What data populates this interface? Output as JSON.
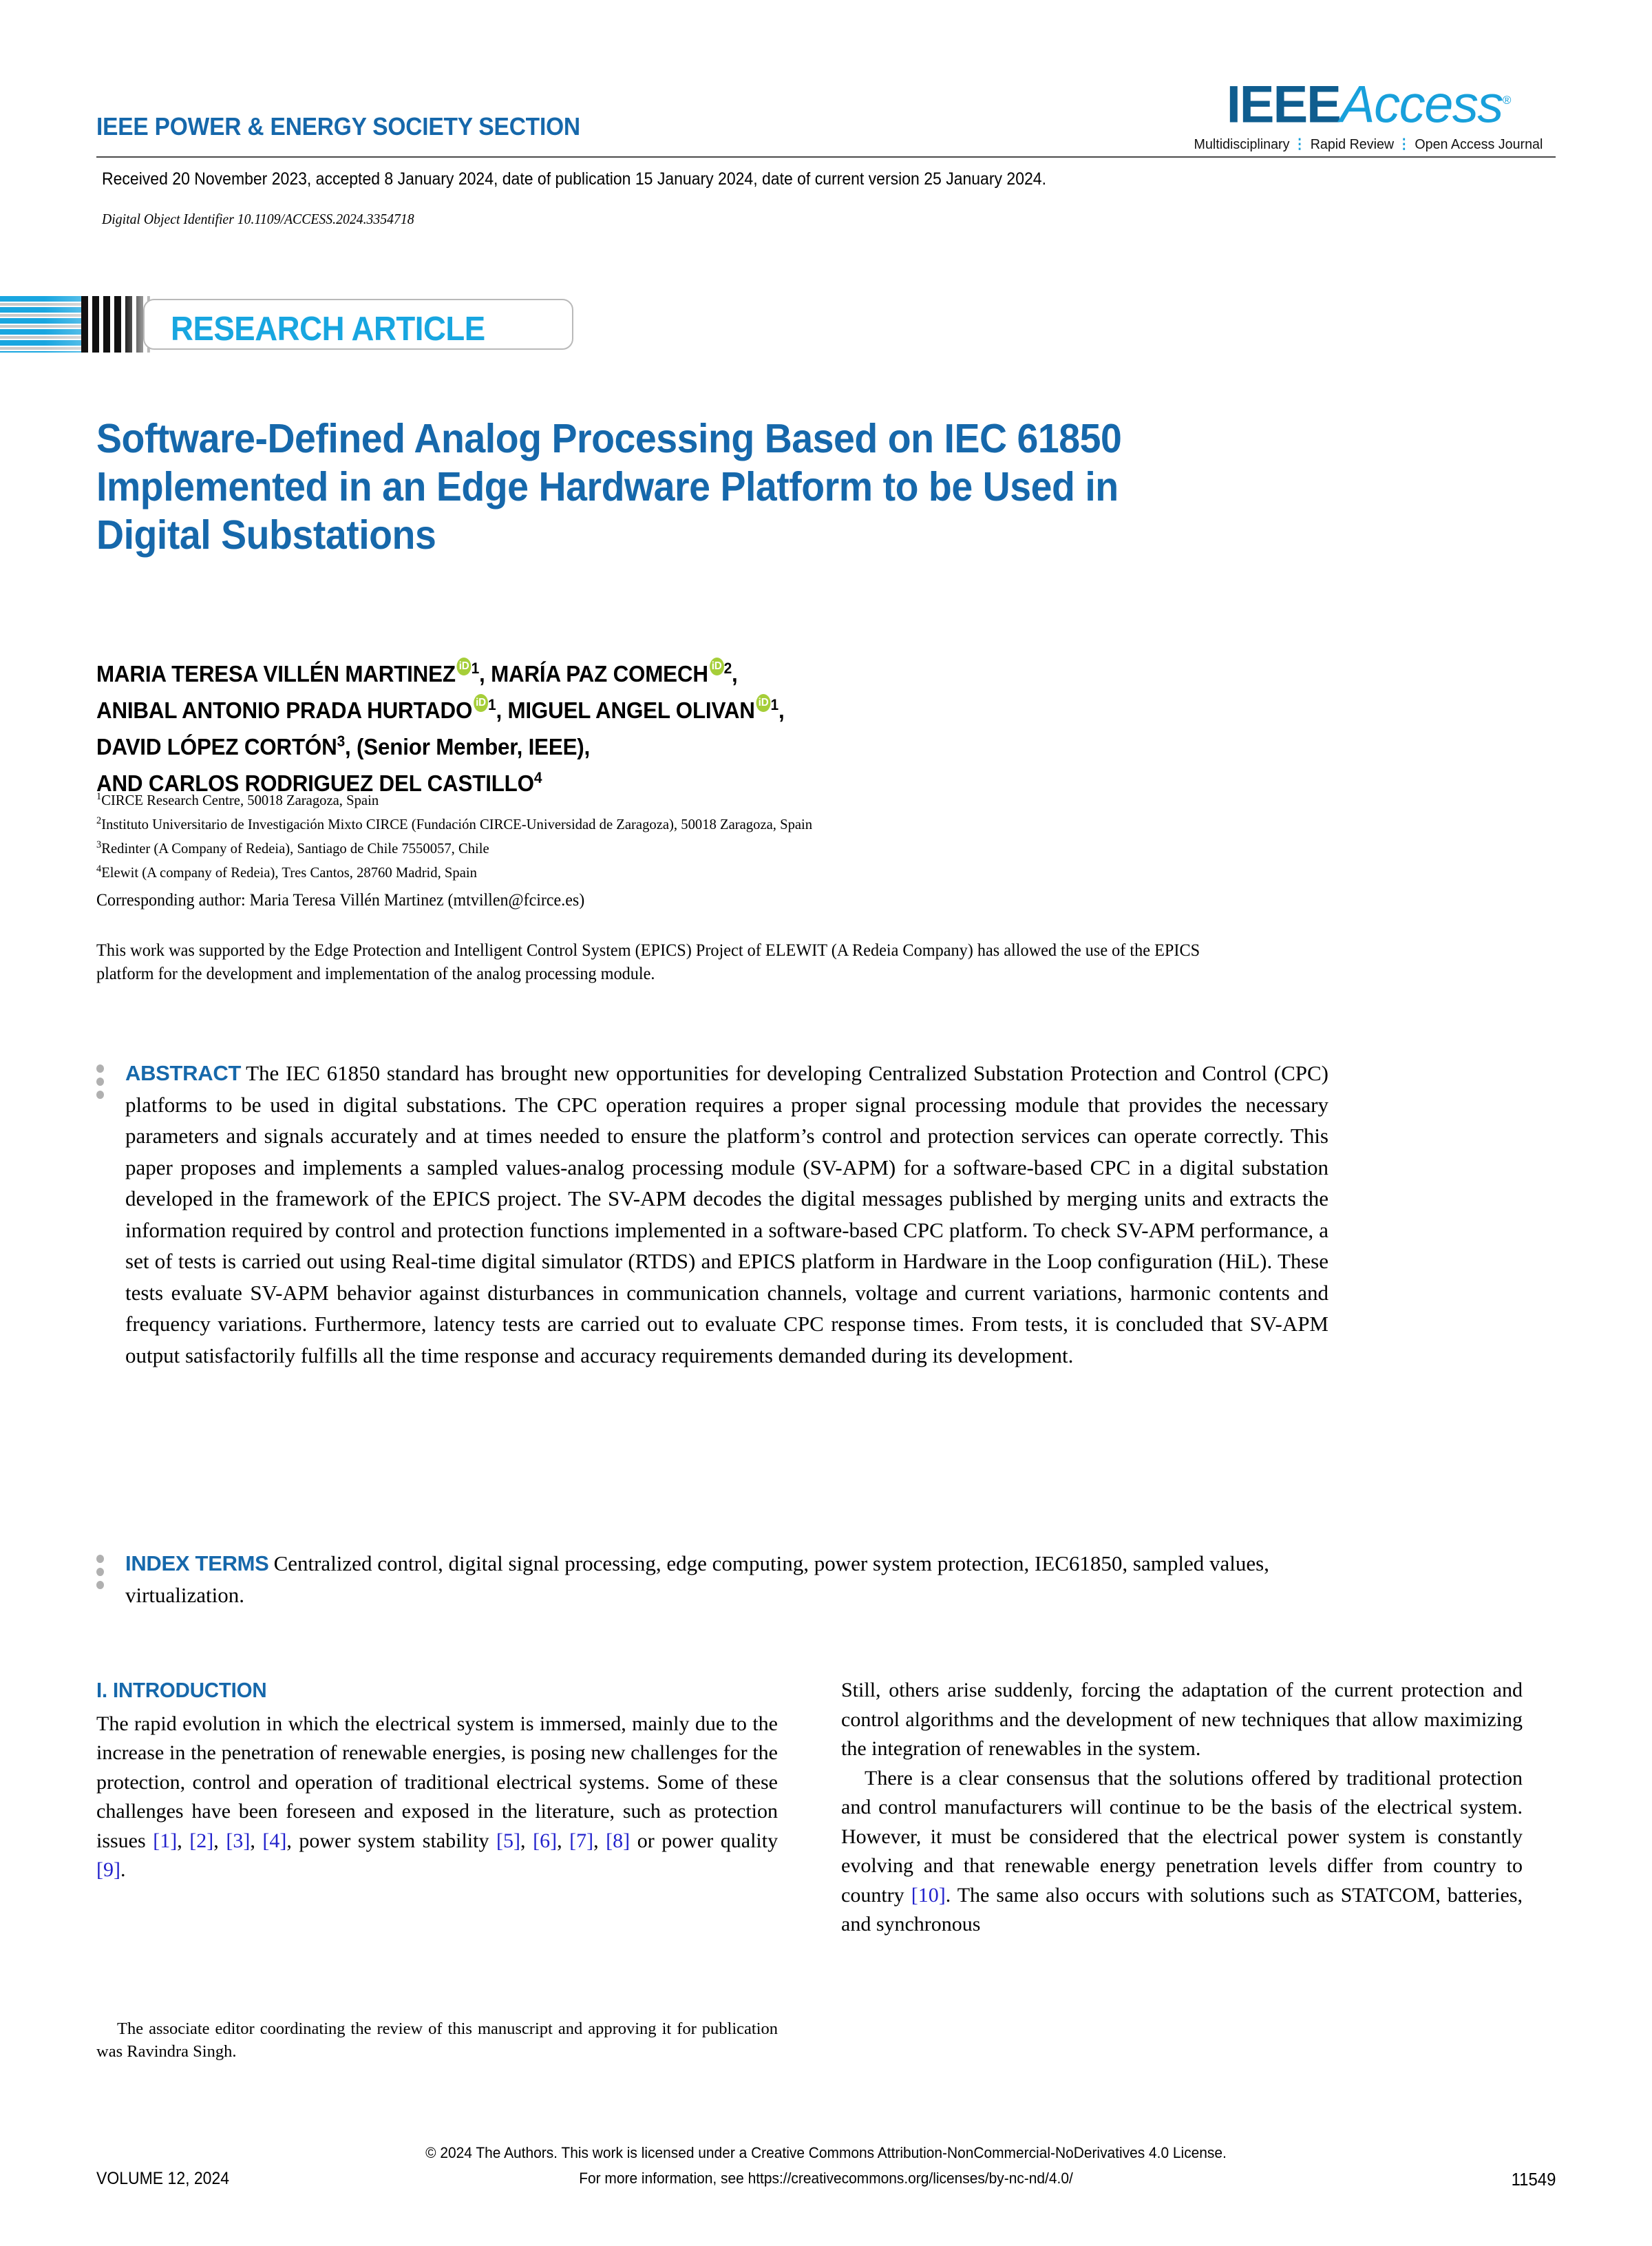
{
  "header": {
    "society_section": "IEEE POWER & ENERGY SOCIETY SECTION",
    "logo": {
      "ieee": "IEEE",
      "access": "Access",
      "registered_mark": "®",
      "tagline_1": "Multidisciplinary",
      "tagline_2": "Rapid Review",
      "tagline_3": "Open Access Journal",
      "separator": "⋮"
    }
  },
  "publication": {
    "dates": "Received 20 November 2023, accepted 8 January 2024, date of publication 15 January 2024, date of current version 25 January 2024.",
    "doi": "Digital Object Identifier 10.1109/ACCESS.2024.3354718"
  },
  "banner": {
    "label": "RESEARCH ARTICLE"
  },
  "title": "Software-Defined Analog Processing Based on IEC 61850 Implemented in an Edge Hardware Platform to be Used in Digital Substations",
  "authors": {
    "line1_a": "MARIA TERESA VILLÉN MARTINEZ",
    "line1_a_sup": "1",
    "line1_b": "MARÍA PAZ COMECH",
    "line1_b_sup": "2",
    "line2_a": "ANIBAL ANTONIO PRADA HURTADO",
    "line2_a_sup": "1",
    "line2_b": "MIGUEL ANGEL OLIVAN",
    "line2_b_sup": "1",
    "line3": "DAVID LÓPEZ CORTÓN",
    "line3_sup": "3",
    "line3_suffix": ", (Senior Member, IEEE),",
    "line4": "AND CARLOS RODRIGUEZ DEL CASTILLO",
    "line4_sup": "4",
    "orcid_glyph": "iD"
  },
  "affiliations": [
    {
      "num": "1",
      "text": "CIRCE Research Centre, 50018 Zaragoza, Spain"
    },
    {
      "num": "2",
      "text": "Instituto Universitario de Investigación Mixto CIRCE (Fundación CIRCE-Universidad de Zaragoza), 50018 Zaragoza, Spain"
    },
    {
      "num": "3",
      "text": "Redinter (A Company of Redeia), Santiago de Chile 7550057, Chile"
    },
    {
      "num": "4",
      "text": "Elewit (A company of Redeia), Tres Cantos, 28760 Madrid, Spain"
    }
  ],
  "corresponding_author": "Corresponding author: Maria Teresa Villén Martinez (mtvillen@fcirce.es)",
  "funding": "This work was supported by the Edge Protection and Intelligent Control System (EPICS) Project of ELEWIT (A Redeia Company) has allowed the use of the EPICS platform for the development and implementation of the analog processing module.",
  "abstract": {
    "label": "ABSTRACT",
    "text": "The IEC 61850 standard has brought new opportunities for developing Centralized Substation Protection and Control (CPC) platforms to be used in digital substations. The CPC operation requires a proper signal processing module that provides the necessary parameters and signals accurately and at times needed to ensure the platform’s control and protection services can operate correctly. This paper proposes and implements a sampled values-analog processing module (SV-APM) for a software-based CPC in a digital substation developed in the framework of the EPICS project. The SV-APM decodes the digital messages published by merging units and extracts the information required by control and protection functions implemented in a software-based CPC platform. To check SV-APM performance, a set of tests is carried out using Real-time digital simulator (RTDS) and EPICS platform in Hardware in the Loop configuration (HiL). These tests evaluate SV-APM behavior against disturbances in communication channels, voltage and current variations, harmonic contents and frequency variations. Furthermore, latency tests are carried out to evaluate CPC response times. From tests, it is concluded that SV-APM output satisfactorily fulfills all the time response and accuracy requirements demanded during its development."
  },
  "index_terms": {
    "label": "INDEX TERMS",
    "text": "Centralized control, digital signal processing, edge computing, power system protection, IEC61850, sampled values, virtualization."
  },
  "introduction": {
    "heading": "I. INTRODUCTION",
    "left_p1_a": "The rapid evolution in which the electrical system is immersed, mainly due to the increase in the penetration of renewable energies, is posing new challenges for the protection, control and operation of traditional electrical systems. Some of these challenges have been foreseen and exposed in the literature, such as protection issues ",
    "left_cites_1": [
      "[1]",
      "[2]",
      "[3]",
      "[4]"
    ],
    "left_p1_b": " power system stability ",
    "left_cites_2": [
      "[5]",
      "[6]",
      "[7]",
      "[8]"
    ],
    "left_p1_c": " or power quality ",
    "left_cite_3": "[9]",
    "left_p1_d": ".",
    "right_p1": "Still, others arise suddenly, forcing the adaptation of the current protection and control algorithms and the development of new techniques that allow maximizing the integration of renewables in the system.",
    "right_p2_a": "There is a clear consensus that the solutions offered by traditional protection and control manufacturers will continue to be the basis of the electrical system. However, it must be considered that the electrical power system is constantly evolving and that renewable energy penetration levels differ from country to country ",
    "right_cite_1": "[10]",
    "right_p2_b": ". The same also occurs with solutions such as STATCOM, batteries, and synchronous"
  },
  "footnote": "The associate editor coordinating the review of this manuscript and approving it for publication was Ravindra Singh.",
  "footer": {
    "volume": "VOLUME 12, 2024",
    "license_line1": "© 2024 The Authors. This work is licensed under a Creative Commons Attribution-NonCommercial-NoDerivatives 4.0 License.",
    "license_line2": "For more information, see https://creativecommons.org/licenses/by-nc-nd/4.0/",
    "page_number": "11549"
  },
  "colors": {
    "ieee_blue": "#1668ab",
    "access_cyan": "#18a0db",
    "banner_cyan": "#18a6e0",
    "orcid_green": "#a6ce39",
    "citation_blue": "#2222cc"
  }
}
